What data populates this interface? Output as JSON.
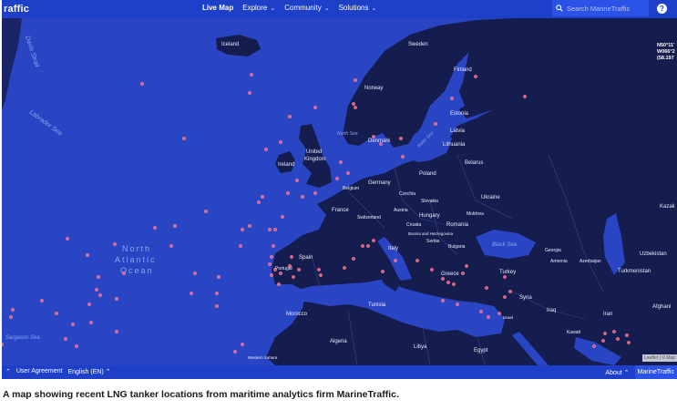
{
  "header": {
    "logo": "raffic",
    "nav": [
      {
        "label": "Live Map",
        "active": true,
        "dropdown": false
      },
      {
        "label": "Explore",
        "active": false,
        "dropdown": true
      },
      {
        "label": "Community",
        "active": false,
        "dropdown": true
      },
      {
        "label": "Solutions",
        "active": false,
        "dropdown": true
      }
    ],
    "search_placeholder": "Search MarineTraffic",
    "help_label": "?"
  },
  "map": {
    "coords": [
      "N50°11'",
      "W066°2",
      "(58.197"
    ],
    "attribution": "Leaflet | © Map",
    "labels": {
      "iceland": "Iceland",
      "sweden": "Sweden",
      "finland": "Finland",
      "norway": "Norway",
      "estonia": "Estonia",
      "latvia": "Latvia",
      "lithuania": "Lithuania",
      "denmark": "Denmark",
      "united_kingdom_1": "United",
      "united_kingdom_2": "Kingdom",
      "ireland": "Ireland",
      "belarus": "Belarus",
      "poland": "Poland",
      "germany": "Germany",
      "belgium": "Belgium",
      "czechia": "Czechia",
      "slovakia": "Slovakia",
      "ukraine": "Ukraine",
      "france": "France",
      "austria": "Austria",
      "hungary": "Hungary",
      "moldova": "Moldova",
      "switzerland": "Switzerland",
      "croatia": "Croatia",
      "romania": "Romania",
      "bosnia": "Bosnia and Herzegovina",
      "serbia": "Serbia",
      "bulgaria": "Bulgaria",
      "italy": "Italy",
      "spain": "Spain",
      "portugal": "Portugal",
      "greece": "Greece",
      "turkey": "Turkey",
      "georgia": "Georgia",
      "armenia": "Armenia",
      "azerbaijan": "Azerbaijan",
      "uzbekistan": "Uzbekistan",
      "turkmenistan": "Turkmenistan",
      "kazakhstan": "Kazak",
      "afghanistan": "Afghani",
      "syria": "Syria",
      "iraq": "Iraq",
      "iran": "Iran",
      "kuwait": "Kuwait",
      "israel": "Israel",
      "tunisia": "Tunisia",
      "morocco": "Morocco",
      "algeria": "Algeria",
      "libya": "Libya",
      "egypt": "Egypt",
      "western_sahara": "Western Sahara",
      "north_atlantic_1": "North",
      "north_atlantic_2": "Atlantic",
      "north_atlantic_3": "Ocean",
      "black_sea": "Black Sea",
      "baltic_sea": "Baltic Sea",
      "north_sea": "North Sea",
      "davis_strait": "Davis Strait",
      "labrador_sea": "Labrador Sea",
      "sargasso_sea": "Sargasso Sea"
    }
  },
  "footer": {
    "user_agreement": "User Agreement",
    "language": "English (EN)",
    "about": "About",
    "marinetraffic": "MarineTraffic"
  },
  "caption": "A map showing recent LNG tanker locations from maritime analytics firm MarineTraffic.",
  "colors": {
    "ocean": "#2a45c4",
    "land": "#151c4e",
    "bar": "#1e3fc8",
    "vessel": "#ff4d6d"
  }
}
